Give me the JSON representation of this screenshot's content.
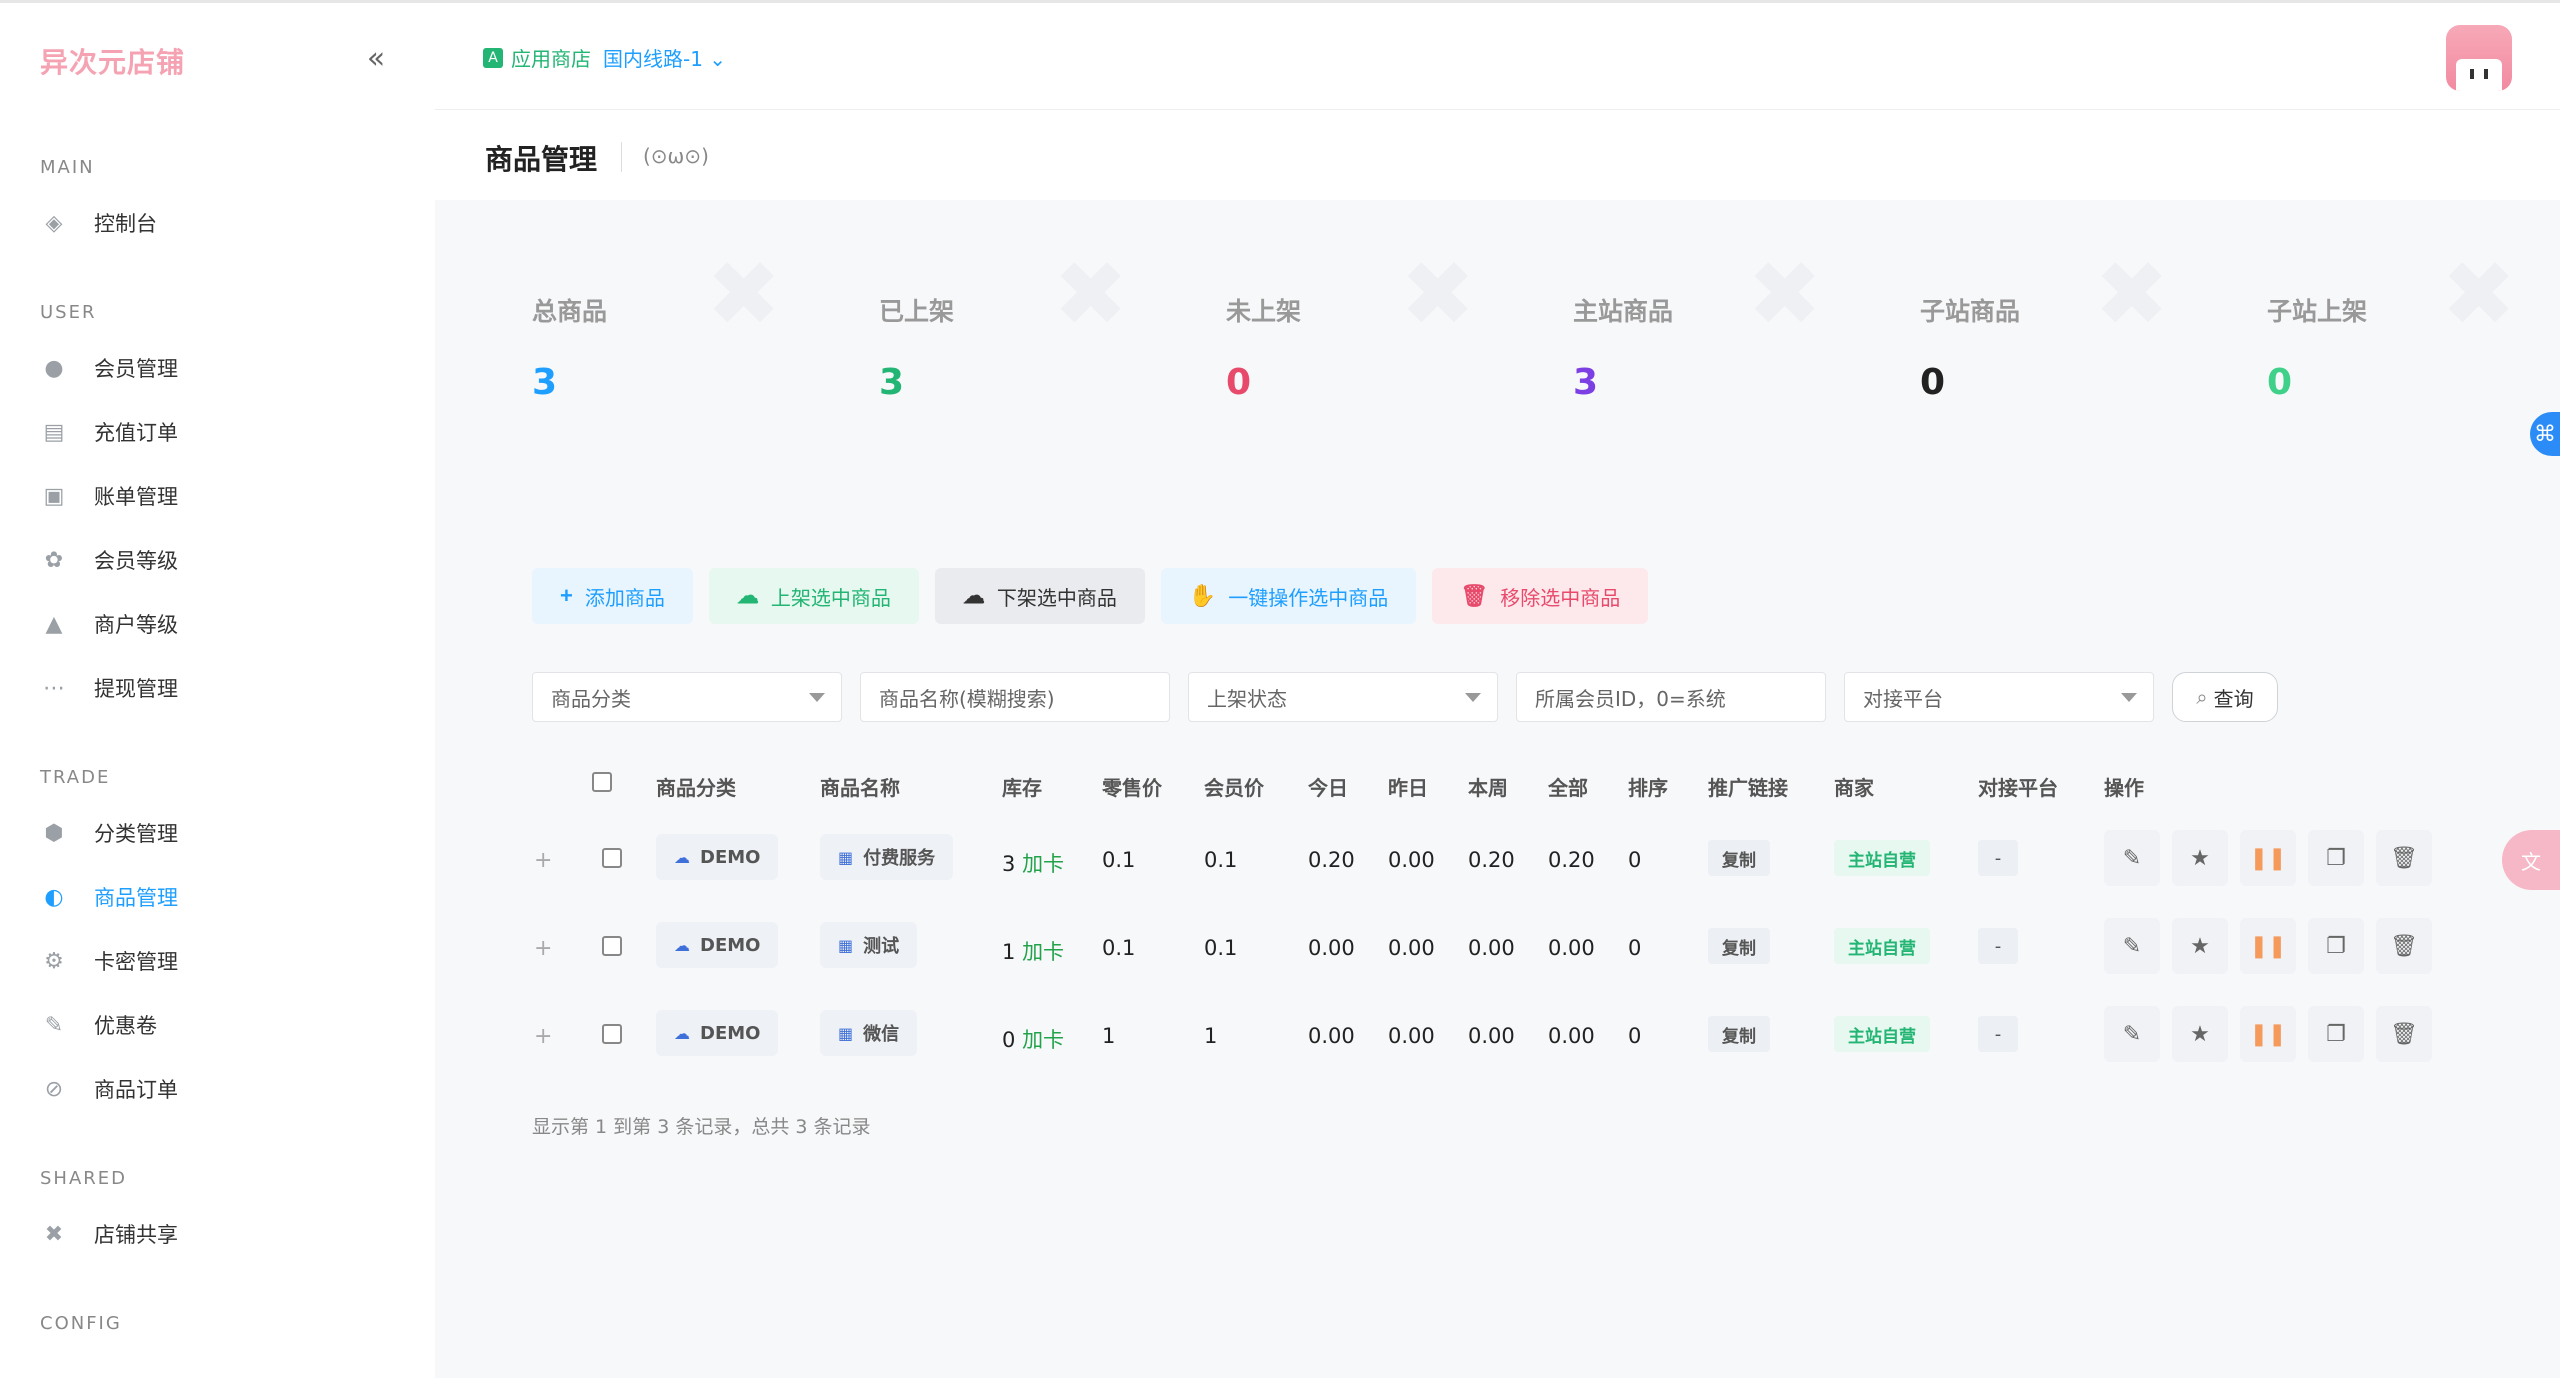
{
  "brand": "异次元店铺",
  "sidebar": {
    "sections": [
      "MAIN",
      "USER",
      "TRADE",
      "SHARED",
      "CONFIG"
    ],
    "items": [
      {
        "label": "控制台",
        "icon": "dashboard-icon"
      },
      {
        "label": "会员管理",
        "icon": "user-icon"
      },
      {
        "label": "充值订单",
        "icon": "recharge-icon"
      },
      {
        "label": "账单管理",
        "icon": "bill-icon"
      },
      {
        "label": "会员等级",
        "icon": "level-icon"
      },
      {
        "label": "商户等级",
        "icon": "merchant-icon"
      },
      {
        "label": "提现管理",
        "icon": "withdraw-icon"
      },
      {
        "label": "分类管理",
        "icon": "category-icon"
      },
      {
        "label": "商品管理",
        "icon": "goods-icon"
      },
      {
        "label": "卡密管理",
        "icon": "card-icon"
      },
      {
        "label": "优惠卷",
        "icon": "coupon-icon"
      },
      {
        "label": "商品订单",
        "icon": "order-icon"
      },
      {
        "label": "店铺共享",
        "icon": "share-icon"
      }
    ]
  },
  "header": {
    "app_store": "应用商店",
    "line": "国内线路-1"
  },
  "page": {
    "title": "商品管理",
    "emote": "(⊙ω⊙)"
  },
  "stats": [
    {
      "label": "总商品",
      "value": "3",
      "color": "#1e9fff"
    },
    {
      "label": "已上架",
      "value": "3",
      "color": "#22b573"
    },
    {
      "label": "未上架",
      "value": "0",
      "color": "#e84a6b"
    },
    {
      "label": "主站商品",
      "value": "3",
      "color": "#7b3fe4"
    },
    {
      "label": "子站商品",
      "value": "0",
      "color": "#222222"
    },
    {
      "label": "子站上架",
      "value": "0",
      "color": "#3fd08a"
    }
  ],
  "toolbar": {
    "add": "添加商品",
    "up": "上架选中商品",
    "down": "下架选中商品",
    "one_click": "一键操作选中商品",
    "remove": "移除选中商品"
  },
  "filters": {
    "category": "商品分类",
    "name": "商品名称(模糊搜索)",
    "status": "上架状态",
    "member": "所属会员ID，0=系统",
    "platform": "对接平台",
    "query": "查询"
  },
  "table": {
    "headers": [
      "商品分类",
      "商品名称",
      "库存",
      "零售价",
      "会员价",
      "今日",
      "昨日",
      "本周",
      "全部",
      "排序",
      "推广链接",
      "商家",
      "对接平台",
      "操作"
    ],
    "rows": [
      {
        "category": "DEMO",
        "name": "付费服务",
        "stock": "3",
        "add_card": "加卡",
        "retail": "0.1",
        "member": "0.1",
        "today": "0.20",
        "yesterday": "0.00",
        "week": "0.20",
        "all": "0.20",
        "sort": "0",
        "promo": "复制",
        "merchant": "主站自营",
        "platform": "-"
      },
      {
        "category": "DEMO",
        "name": "测试",
        "stock": "1",
        "add_card": "加卡",
        "retail": "0.1",
        "member": "0.1",
        "today": "0.00",
        "yesterday": "0.00",
        "week": "0.00",
        "all": "0.00",
        "sort": "0",
        "promo": "复制",
        "merchant": "主站自营",
        "platform": "-"
      },
      {
        "category": "DEMO",
        "name": "微信",
        "stock": "0",
        "add_card": "加卡",
        "retail": "1",
        "member": "1",
        "today": "0.00",
        "yesterday": "0.00",
        "week": "0.00",
        "all": "0.00",
        "sort": "0",
        "promo": "复制",
        "merchant": "主站自营",
        "platform": "-"
      }
    ]
  },
  "footer": "显示第 1 到第 3 条记录，总共 3 条记录"
}
